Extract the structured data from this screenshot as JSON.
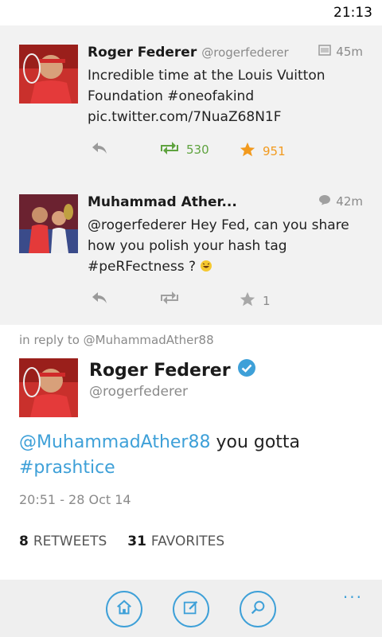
{
  "status_bar": {
    "time": "21:13"
  },
  "timeline": [
    {
      "name": "Roger Federer",
      "handle": "@rogerfederer",
      "time": "45m",
      "body": "Incredible time at the Louis Vuitton Foundation #oneofakind pic.twitter.com/7NuaZ68N1F",
      "retweets": "530",
      "favorites": "951"
    },
    {
      "name": "Muhammad Ather...",
      "time": "42m",
      "body": "@rogerfederer Hey Fed, can you share how you polish your hash tag #peRFectness ?",
      "favorites": "1"
    }
  ],
  "detail": {
    "in_reply_to": "in reply to @MuhammadAther88",
    "name": "Roger Federer",
    "handle": "@rogerfederer",
    "mention": "@MuhammadAther88",
    "text": " you gotta",
    "hashtag": "#prashtice",
    "timestamp": "20:51 - 28 Oct 14",
    "retweets_count": "8",
    "retweets_label": "RETWEETS",
    "favorites_count": "31",
    "favorites_label": "FAVORITES"
  },
  "app_bar": {
    "more": "..."
  },
  "colors": {
    "accent": "#3ea0d8",
    "retweet": "#5fa33f",
    "favorite": "#f29a1e"
  }
}
